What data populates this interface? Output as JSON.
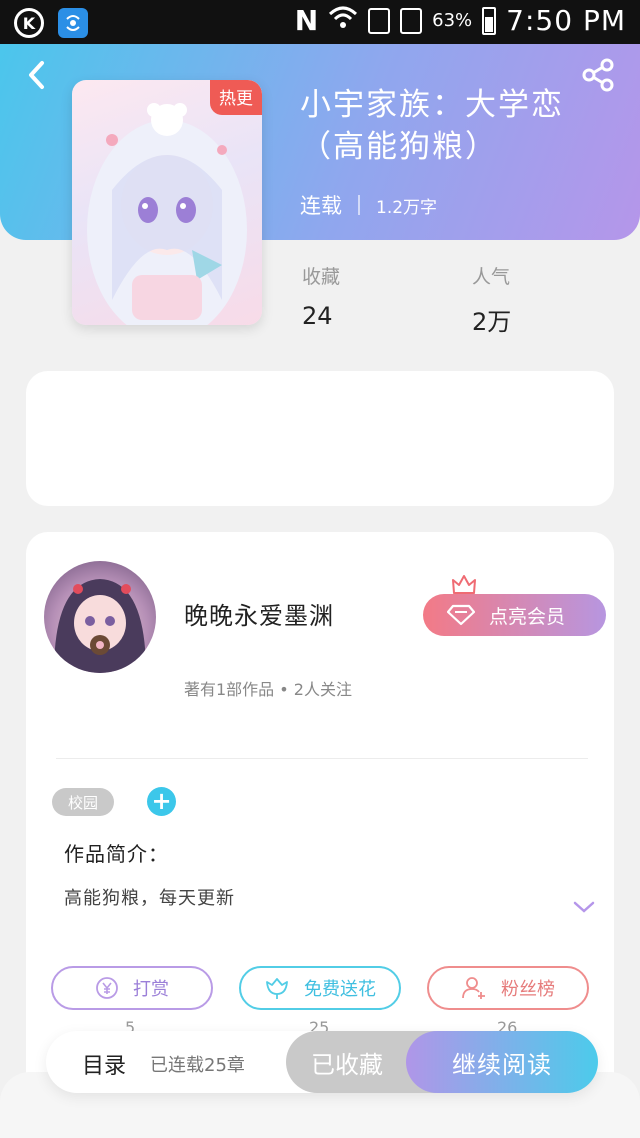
{
  "status_bar": {
    "left_icons": [
      "k-circle-icon",
      "wifi-app-icon"
    ],
    "right_icons": [
      "n-icon",
      "wifi-signal-icon",
      "sim1-icon",
      "sim2-icon",
      "battery-icon"
    ],
    "k_glyph": "K",
    "n_glyph": "N",
    "battery": "63%",
    "time": "7:50 PM"
  },
  "header": {
    "hot_badge": "热更",
    "title": "小宇家族：大学恋（高能狗粮）",
    "status": "连载",
    "word_count": "1.2万字",
    "stats": [
      {
        "label": "收藏",
        "value": "24"
      },
      {
        "label": "人气",
        "value": "2万"
      }
    ],
    "colors": {
      "start": "#4bc6ec",
      "end": "#b596ea"
    }
  },
  "author": {
    "name": "晚晚永爱墨渊",
    "meta": "著有1部作品 • 2人关注",
    "vip_label": "点亮会员"
  },
  "work": {
    "tags": [
      "校园"
    ],
    "add_tag": "+",
    "intro_title": "作品简介：",
    "intro_text": "高能狗粮，每天更新"
  },
  "actions": [
    {
      "label": "打赏",
      "icon": "yen-icon",
      "count": "5"
    },
    {
      "label": "免费送花",
      "icon": "flower-icon",
      "count": "25"
    },
    {
      "label": "粉丝榜",
      "icon": "fan-user-icon",
      "count": "26"
    }
  ],
  "bottom_bar": {
    "toc_label": "目录",
    "toc_sub": "已连载25章",
    "fav_label": "已收藏",
    "read_label": "继续阅读"
  }
}
